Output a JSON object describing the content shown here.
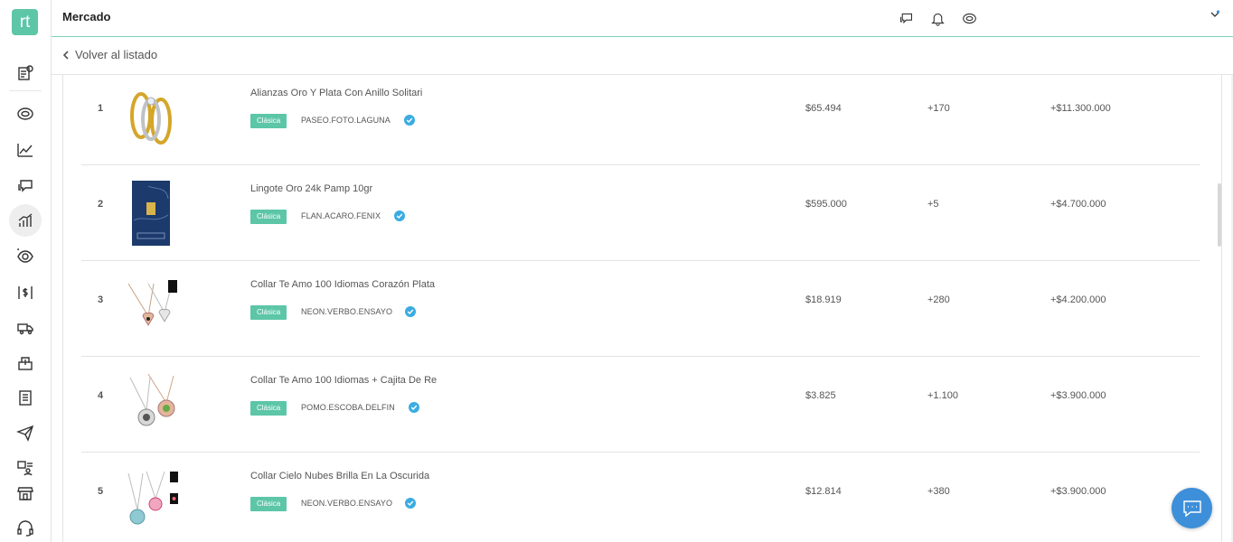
{
  "app": {
    "logo_text": "rt",
    "accent_color": "#5cc6a7",
    "title": "Mercado"
  },
  "header": {
    "icons": [
      "chat-bubbles-icon",
      "bell-icon",
      "avatar-icon",
      "caret-down-icon"
    ]
  },
  "subheader": {
    "back_label": "Volver al listado"
  },
  "sidebar": {
    "items": [
      {
        "icon": "document-notification-icon"
      },
      {
        "icon": "avatar-icon"
      },
      {
        "icon": "line-chart-icon"
      },
      {
        "icon": "chat-bubbles-icon"
      },
      {
        "icon": "bar-chart-icon",
        "active": true
      },
      {
        "icon": "eye-icon"
      },
      {
        "icon": "money-transfer-icon"
      },
      {
        "icon": "delivery-truck-icon"
      },
      {
        "icon": "box-upload-icon"
      },
      {
        "icon": "document-list-icon"
      },
      {
        "icon": "paper-plane-icon"
      },
      {
        "icon": "users-list-icon"
      },
      {
        "icon": "store-icon"
      },
      {
        "icon": "headset-icon"
      }
    ]
  },
  "products": [
    {
      "rank": "1",
      "name": "Alianzas Oro Y Plata Con Anillo Solitari",
      "badge": "Clásica",
      "seller": "PASEO.FOTO.LAGUNA",
      "price": "$65.494",
      "sold": "+170",
      "revenue": "+$11.300.000"
    },
    {
      "rank": "2",
      "name": "Lingote Oro 24k Pamp 10gr",
      "badge": "Clásica",
      "seller": "FLAN.ACARO.FENIX",
      "price": "$595.000",
      "sold": "+5",
      "revenue": "+$4.700.000"
    },
    {
      "rank": "3",
      "name": "Collar Te Amo 100 Idiomas Corazón Plata",
      "badge": "Clásica",
      "seller": "NEON.VERBO.ENSAYO",
      "price": "$18.919",
      "sold": "+280",
      "revenue": "+$4.200.000"
    },
    {
      "rank": "4",
      "name": "Collar Te Amo 100 Idiomas + Cajita De Re",
      "badge": "Clásica",
      "seller": "POMO.ESCOBA.DELFIN",
      "price": "$3.825",
      "sold": "+1.100",
      "revenue": "+$3.900.000"
    },
    {
      "rank": "5",
      "name": "Collar Cielo Nubes Brilla En La Oscurida",
      "badge": "Clásica",
      "seller": "NEON.VERBO.ENSAYO",
      "price": "$12.814",
      "sold": "+380",
      "revenue": "+$3.900.000"
    }
  ],
  "chat_fab": {
    "icon": "chat-icon"
  }
}
